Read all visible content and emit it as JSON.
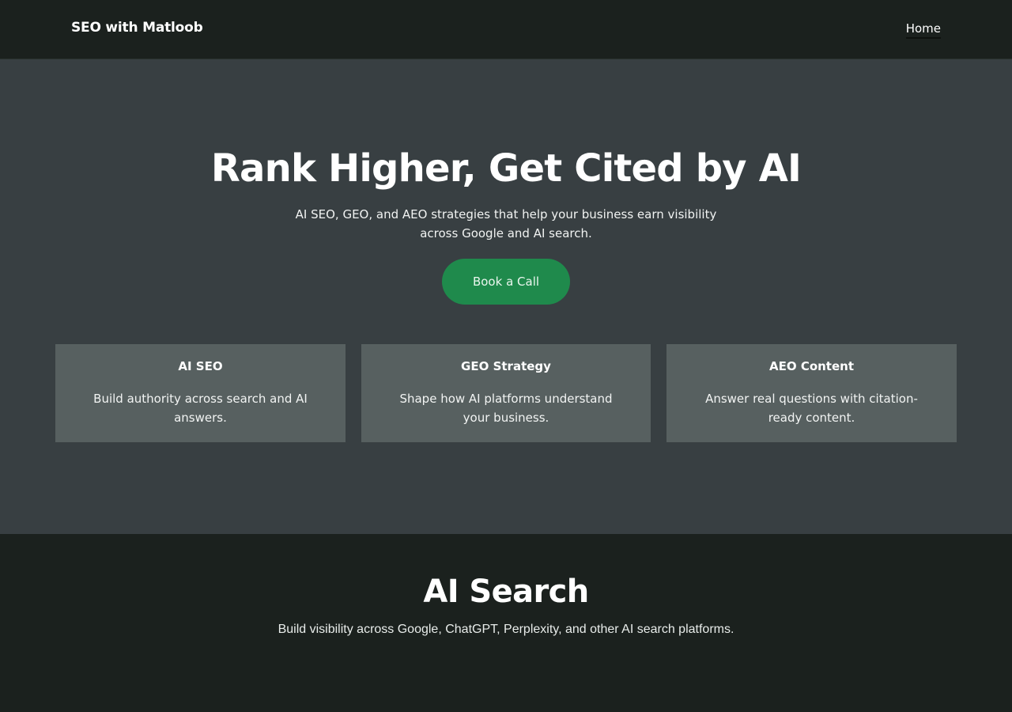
{
  "header": {
    "brand": "SEO with Matloob",
    "nav": [
      {
        "label": "Home"
      }
    ]
  },
  "hero": {
    "title": "Rank Higher, Get Cited by AI",
    "subtitle": "AI SEO, GEO, and AEO strategies that help your business earn visibility across Google and AI search.",
    "cta_label": "Book a Call"
  },
  "cards": [
    {
      "title": "AI SEO",
      "text": "Build authority across search and AI answers."
    },
    {
      "title": "GEO Strategy",
      "text": "Shape how AI platforms understand your business."
    },
    {
      "title": "AEO Content",
      "text": "Answer real questions with citation-ready content."
    }
  ],
  "section": {
    "title": "AI Search",
    "subtitle": "Build visibility across Google, ChatGPT, Perplexity, and other AI search platforms."
  },
  "colors": {
    "header_bg": "#1b211e",
    "hero_bg": "#383f42",
    "card_bg": "#576060",
    "accent": "#1f8a4c"
  }
}
